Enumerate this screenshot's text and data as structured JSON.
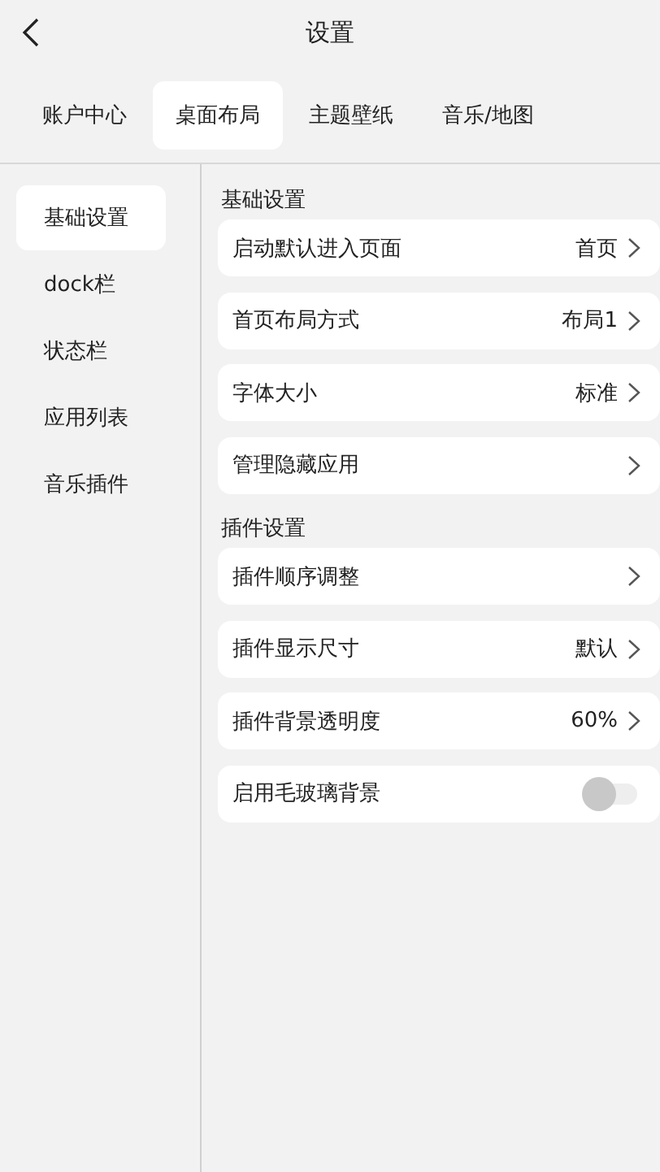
{
  "header": {
    "title": "设置"
  },
  "tabs": [
    {
      "label": "账户中心",
      "selected": false
    },
    {
      "label": "桌面布局",
      "selected": true
    },
    {
      "label": "主题壁纸",
      "selected": false
    },
    {
      "label": "音乐/地图",
      "selected": false
    }
  ],
  "sidebar": {
    "items": [
      {
        "label": "基础设置",
        "selected": true
      },
      {
        "label": "dock栏",
        "selected": false
      },
      {
        "label": "状态栏",
        "selected": false
      },
      {
        "label": "应用列表",
        "selected": false
      },
      {
        "label": "音乐插件",
        "selected": false
      }
    ]
  },
  "sections": [
    {
      "title": "基础设置",
      "rows": [
        {
          "kind": "link",
          "label": "启动默认进入页面",
          "value": "首页"
        },
        {
          "kind": "link",
          "label": "首页布局方式",
          "value": "布局1"
        },
        {
          "kind": "link",
          "label": "字体大小",
          "value": "标准"
        },
        {
          "kind": "link",
          "label": "管理隐藏应用"
        }
      ]
    },
    {
      "title": "插件设置",
      "rows": [
        {
          "kind": "link",
          "label": "插件顺序调整"
        },
        {
          "kind": "link",
          "label": "插件显示尺寸",
          "value": "默认"
        },
        {
          "kind": "link",
          "label": "插件背景透明度",
          "value": "60%"
        },
        {
          "kind": "toggle",
          "label": "启用毛玻璃背景",
          "on": false
        }
      ]
    }
  ]
}
